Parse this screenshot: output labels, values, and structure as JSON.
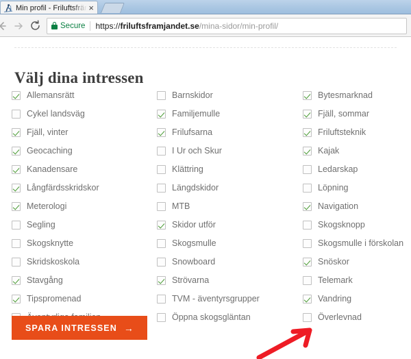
{
  "browser": {
    "tab": {
      "title": "Min profil - Friluftsfrämja",
      "close_label": "×",
      "favicon_name": "skier-favicon"
    },
    "new_tab_label": "",
    "nav": {
      "back_label": "",
      "forward_label": "",
      "reload_label": ""
    },
    "omnibox": {
      "security_label": "Secure",
      "url_scheme": "https://",
      "url_domain": "friluftsframjandet.se",
      "url_path": "/mina-sidor/min-profil/",
      "url_full": "https://friluftsframjandet.se/mina-sidor/min-profil/"
    }
  },
  "page": {
    "title": "Välj dina intressen",
    "save_button": {
      "label": "SPARA INTRESSEN",
      "arrow": "→"
    },
    "columns": [
      {
        "items": [
          {
            "label": "Allemansrätt",
            "checked": true
          },
          {
            "label": "Cykel landsväg",
            "checked": false
          },
          {
            "label": "Fjäll, vinter",
            "checked": true
          },
          {
            "label": "Geocaching",
            "checked": true
          },
          {
            "label": "Kanadensare",
            "checked": true
          },
          {
            "label": "Långfärdsskridskor",
            "checked": true
          },
          {
            "label": "Meterologi",
            "checked": true
          },
          {
            "label": "Segling",
            "checked": false
          },
          {
            "label": "Skogsknytte",
            "checked": false
          },
          {
            "label": "Skridskoskola",
            "checked": false
          },
          {
            "label": "Stavgång",
            "checked": true
          },
          {
            "label": "Tipspromenad",
            "checked": true
          },
          {
            "label": "Äventyrliga familjen",
            "checked": true
          }
        ]
      },
      {
        "items": [
          {
            "label": "Barnskidor",
            "checked": false
          },
          {
            "label": "Familjemulle",
            "checked": true
          },
          {
            "label": "Frilufsarna",
            "checked": true
          },
          {
            "label": "I Ur och Skur",
            "checked": false
          },
          {
            "label": "Klättring",
            "checked": false
          },
          {
            "label": "Längdskidor",
            "checked": false
          },
          {
            "label": "MTB",
            "checked": false
          },
          {
            "label": "Skidor utför",
            "checked": true
          },
          {
            "label": "Skogsmulle",
            "checked": false
          },
          {
            "label": "Snowboard",
            "checked": false
          },
          {
            "label": "Strövarna",
            "checked": true
          },
          {
            "label": "TVM - äventyrsgrupper",
            "checked": false
          },
          {
            "label": "Öppna skogsgläntan",
            "checked": false
          }
        ]
      },
      {
        "items": [
          {
            "label": "Bytesmarknad",
            "checked": true
          },
          {
            "label": "Fjäll, sommar",
            "checked": true
          },
          {
            "label": "Friluftsteknik",
            "checked": true
          },
          {
            "label": "Kajak",
            "checked": true
          },
          {
            "label": "Ledarskap",
            "checked": false
          },
          {
            "label": "Löpning",
            "checked": false
          },
          {
            "label": "Navigation",
            "checked": true
          },
          {
            "label": "Skogsknopp",
            "checked": false
          },
          {
            "label": "Skogsmulle i förskolan",
            "checked": false
          },
          {
            "label": "Snöskor",
            "checked": true
          },
          {
            "label": "Telemark",
            "checked": false
          },
          {
            "label": "Vandring",
            "checked": true
          },
          {
            "label": "Överlevnad",
            "checked": false
          }
        ]
      }
    ]
  },
  "annotation": {
    "type": "arrow",
    "color": "#ee1c25",
    "points_to": "Vandring"
  },
  "colors": {
    "accent_orange": "#e84d19",
    "check_green": "#4a9b34",
    "secure_green": "#0b8043",
    "annotation_red": "#ee1c25",
    "tab_strip_blue": "#a9c6e2"
  }
}
